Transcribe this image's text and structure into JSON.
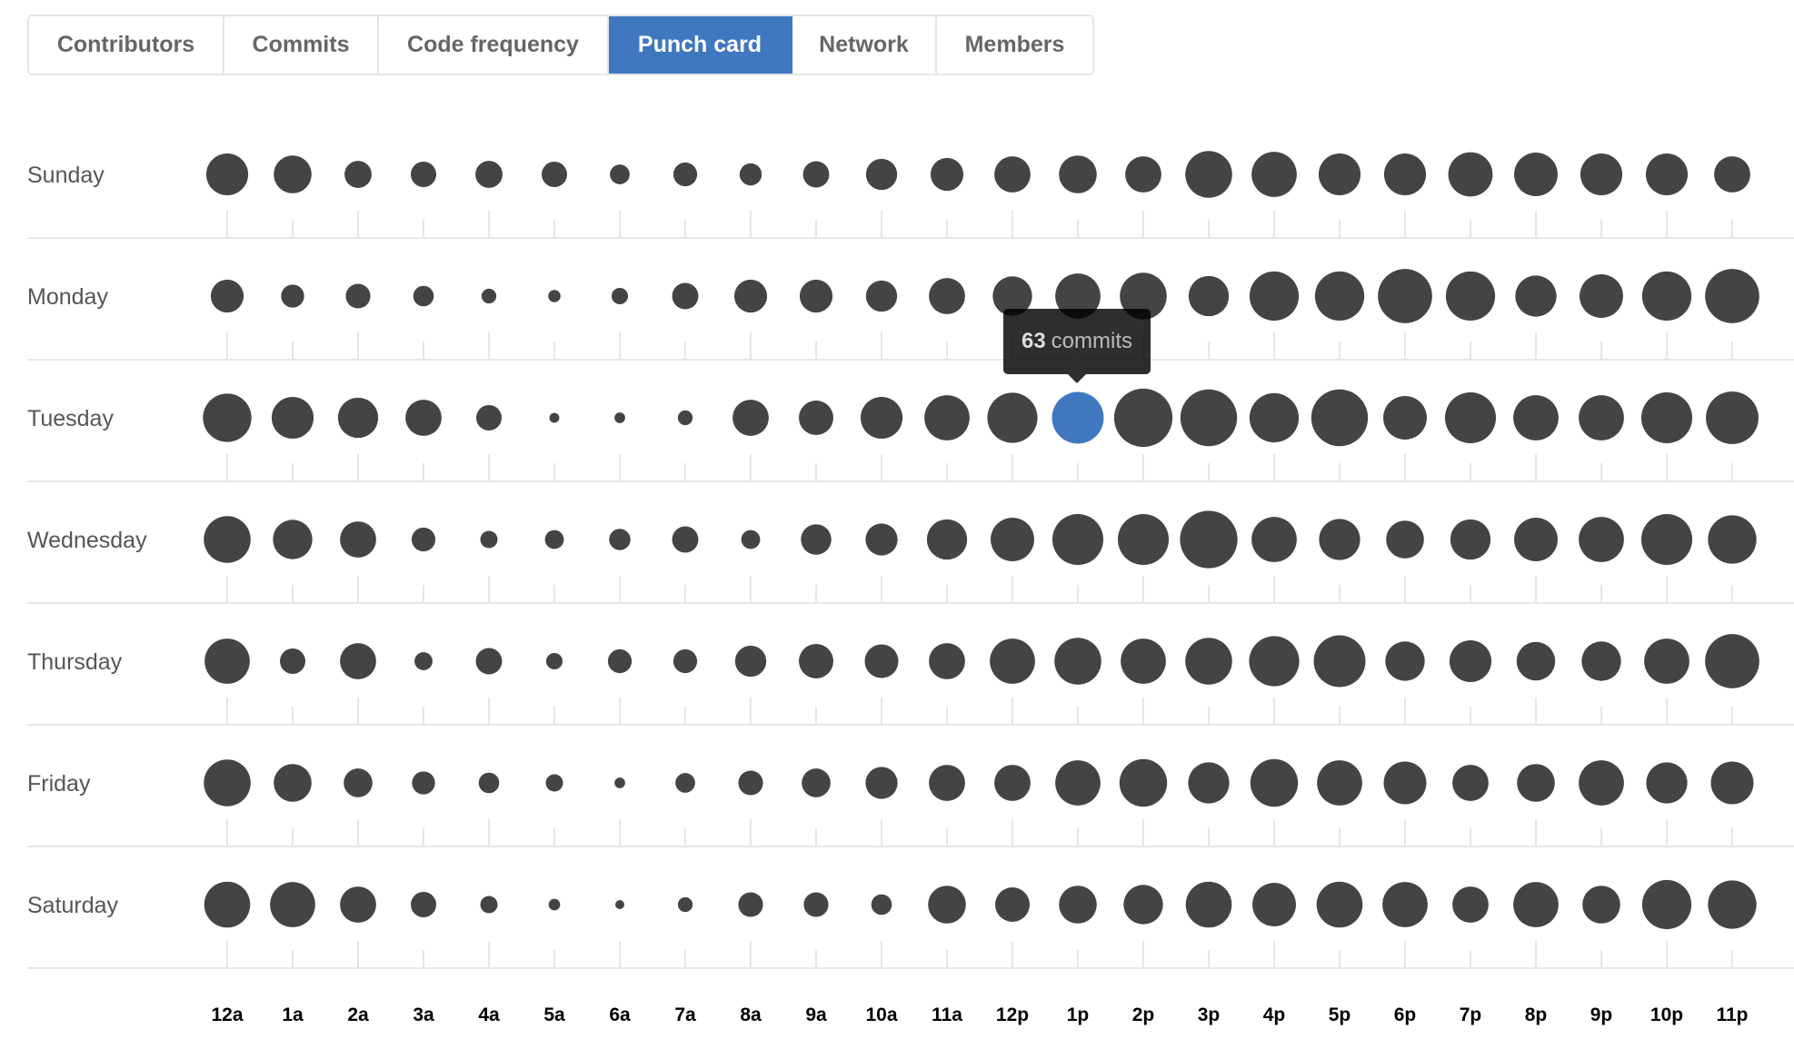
{
  "tabs": [
    {
      "label": "Contributors",
      "active": false
    },
    {
      "label": "Commits",
      "active": false
    },
    {
      "label": "Code frequency",
      "active": false
    },
    {
      "label": "Punch card",
      "active": true
    },
    {
      "label": "Network",
      "active": false
    },
    {
      "label": "Members",
      "active": false
    }
  ],
  "colors": {
    "dot": "#444444",
    "dot_highlight": "#4078c0",
    "active_tab": "#4078c0",
    "grid": "#e6e6e6"
  },
  "tooltip": {
    "count": "63",
    "unit": "commits",
    "day": "Tuesday",
    "hour": "1p"
  },
  "chart_data": {
    "type": "scatter",
    "title": "Punch card",
    "xlabel": "",
    "ylabel": "",
    "size_encoding": "commits",
    "days": [
      "Sunday",
      "Monday",
      "Tuesday",
      "Wednesday",
      "Thursday",
      "Friday",
      "Saturday"
    ],
    "hours": [
      "12a",
      "1a",
      "2a",
      "3a",
      "4a",
      "5a",
      "6a",
      "7a",
      "8a",
      "9a",
      "10a",
      "11a",
      "12p",
      "1p",
      "2p",
      "3p",
      "4p",
      "5p",
      "6p",
      "7p",
      "8p",
      "9p",
      "10p",
      "11p"
    ],
    "values": [
      [
        51,
        46,
        33,
        31,
        33,
        31,
        24,
        29,
        27,
        32,
        38,
        40,
        44,
        46,
        44,
        57,
        55,
        51,
        51,
        54,
        53,
        51,
        51,
        44
      ],
      [
        40,
        28,
        30,
        25,
        18,
        15,
        20,
        32,
        40,
        40,
        38,
        44,
        48,
        55,
        57,
        49,
        60,
        60,
        66,
        60,
        50,
        53,
        60,
        66
      ],
      [
        59,
        51,
        49,
        44,
        31,
        12,
        13,
        18,
        44,
        42,
        51,
        55,
        61,
        63,
        71,
        69,
        60,
        69,
        53,
        62,
        55,
        55,
        62,
        64
      ],
      [
        57,
        48,
        44,
        29,
        21,
        23,
        26,
        32,
        23,
        37,
        39,
        49,
        53,
        62,
        62,
        70,
        55,
        50,
        46,
        49,
        53,
        55,
        62,
        59
      ],
      [
        55,
        31,
        44,
        22,
        32,
        20,
        29,
        29,
        38,
        42,
        41,
        44,
        55,
        57,
        55,
        57,
        61,
        63,
        48,
        51,
        47,
        48,
        55,
        66
      ],
      [
        57,
        46,
        35,
        28,
        25,
        21,
        13,
        24,
        30,
        35,
        39,
        44,
        44,
        55,
        58,
        50,
        58,
        55,
        52,
        44,
        46,
        55,
        50,
        52
      ],
      [
        56,
        55,
        44,
        31,
        21,
        14,
        11,
        18,
        30,
        30,
        25,
        46,
        42,
        46,
        48,
        56,
        53,
        56,
        55,
        44,
        55,
        46,
        60,
        59
      ]
    ],
    "highlight": {
      "day": 2,
      "hour": 13,
      "value": 63
    },
    "grid": true,
    "legend": "none"
  }
}
